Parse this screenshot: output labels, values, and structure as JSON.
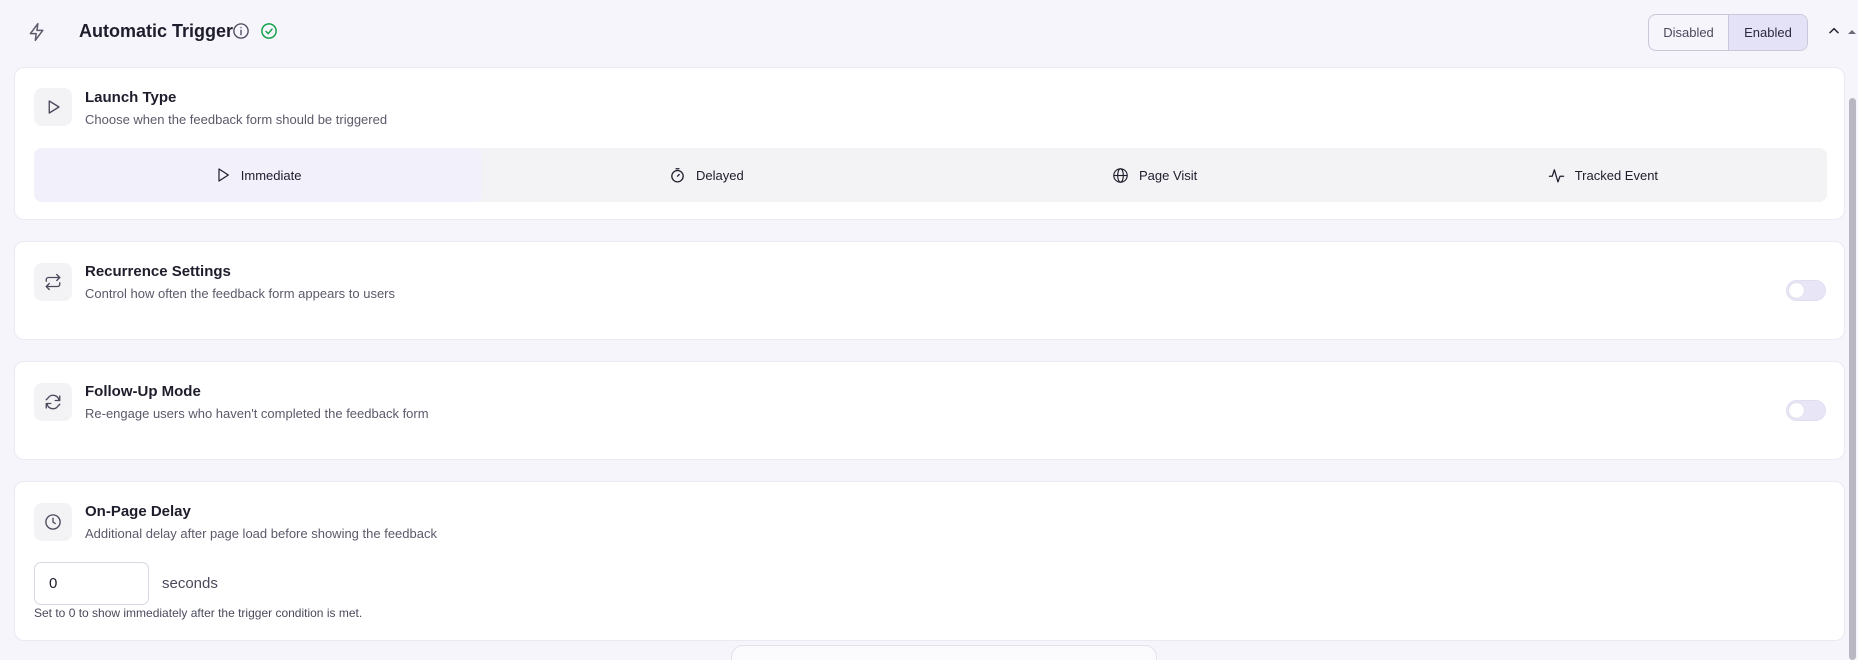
{
  "header": {
    "title": "Automatic Trigger",
    "toggle": {
      "disabled_label": "Disabled",
      "enabled_label": "Enabled",
      "selected": "Enabled"
    },
    "icons": {
      "main": "lightning-bolt-icon",
      "info": "info-icon",
      "status": "check-circle-icon",
      "collapse": "chevron-up-icon"
    }
  },
  "launch_type": {
    "title": "Launch Type",
    "description": "Choose when the feedback form should be triggered",
    "options": [
      {
        "label": "Immediate",
        "icon": "play-icon",
        "selected": true
      },
      {
        "label": "Delayed",
        "icon": "stopwatch-icon",
        "selected": false
      },
      {
        "label": "Page Visit",
        "icon": "globe-icon",
        "selected": false
      },
      {
        "label": "Tracked Event",
        "icon": "activity-icon",
        "selected": false
      }
    ]
  },
  "recurrence": {
    "title": "Recurrence Settings",
    "description": "Control how often the feedback form appears to users",
    "enabled": false
  },
  "follow_up": {
    "title": "Follow-Up Mode",
    "description": "Re-engage users who haven't completed the feedback form",
    "enabled": false
  },
  "on_page_delay": {
    "title": "On-Page Delay",
    "description": "Additional delay after page load before showing the feedback",
    "value": "0",
    "unit": "seconds",
    "hint": "Set to 0 to show immediately after the trigger condition is met."
  },
  "colors": {
    "accent": "#e4e2f6",
    "background": "#f6f5fc",
    "success": "#16a34a"
  }
}
